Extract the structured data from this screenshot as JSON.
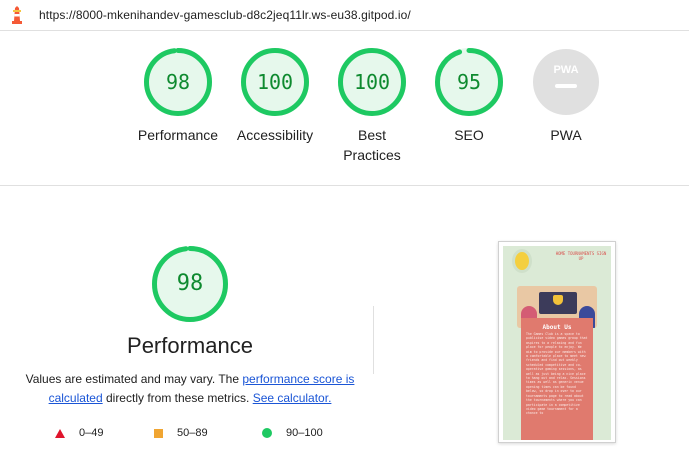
{
  "header": {
    "url": "https://8000-mkenihandev-gamesclub-d8c2jeq11lr.ws-eu38.gitpod.io/"
  },
  "categories": [
    {
      "score": "98",
      "label": "Performance",
      "level": 0.98
    },
    {
      "score": "100",
      "label": "Accessibility",
      "level": 1.0
    },
    {
      "score": "100",
      "label": "Best Practices",
      "level": 1.0
    },
    {
      "score": "95",
      "label": "SEO",
      "level": 0.95
    },
    {
      "badge": "PWA",
      "label": "PWA"
    }
  ],
  "performance": {
    "score": "98",
    "level": 0.98,
    "title": "Performance",
    "desc_prefix": "Values are estimated and may vary. The ",
    "link_score": "performance score is calculated",
    "desc_middle": " directly from these metrics. ",
    "link_calculator": "See calculator."
  },
  "legend": [
    {
      "range": "0–49",
      "shape": "triangle",
      "color": "#e0142c"
    },
    {
      "range": "50–89",
      "shape": "square",
      "color": "#f0a532"
    },
    {
      "range": "90–100",
      "shape": "circle",
      "color": "#1ec962"
    }
  ],
  "screenshot": {
    "nav_text": "HOME TOURNAMENTS SIGN UP",
    "card_title": "About Us",
    "card_text": "The Games Club is a space to publicise video games group that aspires to a relaxing and fun place for people to enjoy. We aim to provide our members with a comfortable place to meet new friends and find out weekly scheduled competitive and co-operative gaming sessions, as well as just being a nice place to hang out and relax. Sessions times as well as generic venue opening times can be found below, so drop in over to our tournaments page to read about the tournaments where you can participate in a competitive video game tournament for a chance to"
  },
  "colors": {
    "pass": "#0e8a2f",
    "pass_ring": "#1ec962",
    "pass_fill": "#e6f8ec",
    "pwa_gray": "#e0e0e0"
  }
}
